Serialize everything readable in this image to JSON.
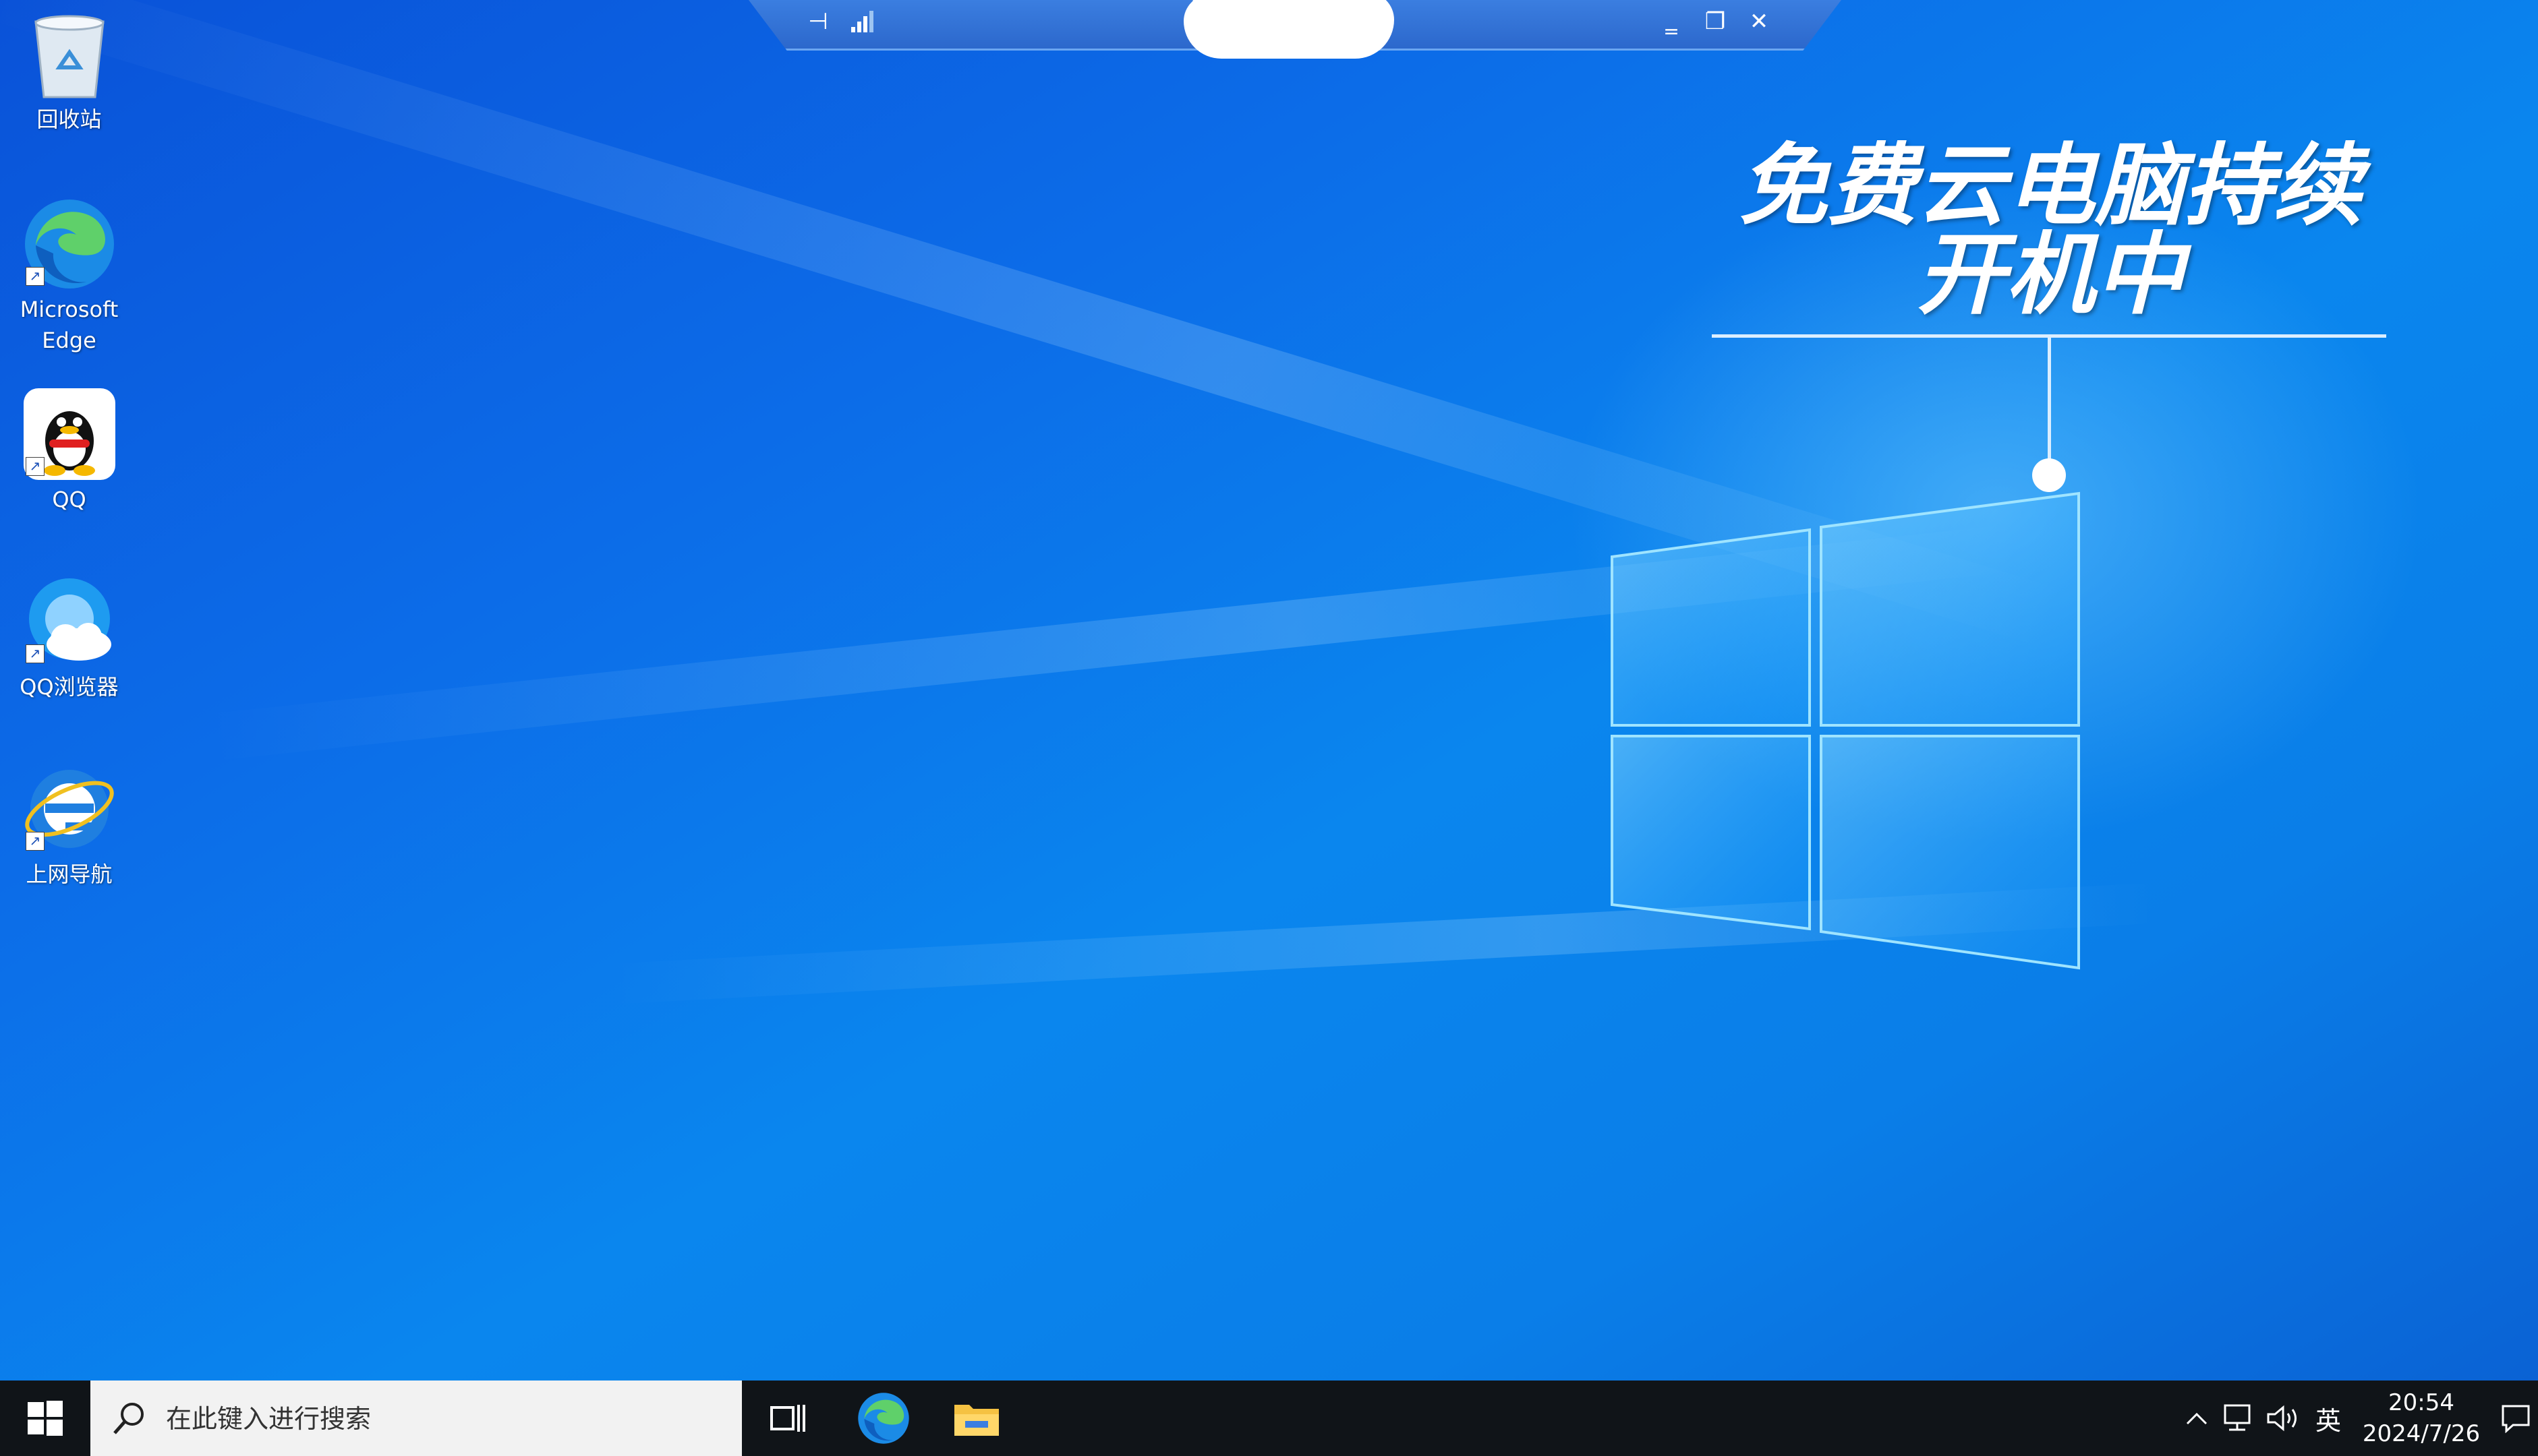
{
  "desktop_icons": [
    {
      "label": "回收站",
      "icon": "recycle-bin-icon"
    },
    {
      "label": "Microsoft Edge",
      "icon": "edge-icon"
    },
    {
      "label": "QQ",
      "icon": "qq-icon"
    },
    {
      "label": "QQ浏览器",
      "icon": "qq-browser-icon"
    },
    {
      "label": "上网导航",
      "icon": "ie-icon"
    }
  ],
  "overlay": {
    "line1": "免费云电脑持续",
    "line2": "开机中"
  },
  "remote_toolbar": {
    "pin": "⊣",
    "minimize": "‗",
    "restore": "❐",
    "close": "✕"
  },
  "taskbar": {
    "search_placeholder": "在此键入进行搜索",
    "ime": "英",
    "time": "20:54",
    "date": "2024/7/26"
  },
  "colors": {
    "taskbar_bg": "#101418",
    "desktop_accent": "#0a7ee8",
    "search_bg": "#f2f2f2"
  }
}
